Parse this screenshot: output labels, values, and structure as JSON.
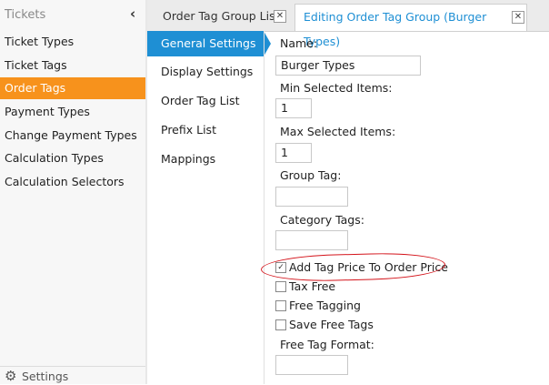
{
  "left_nav": {
    "header": "Tickets",
    "collapse_icon": "chevron-left-icon",
    "items": [
      "Ticket Types",
      "Ticket Tags",
      "Order Tags",
      "Payment Types",
      "Change Payment Types",
      "Calculation Types",
      "Calculation Selectors"
    ],
    "active_item": "Order Tags",
    "footer": {
      "icon": "gear-icon",
      "label": "Settings"
    },
    "accent_color": "#f7921c"
  },
  "tabs": [
    {
      "label": "Order Tag Group List",
      "active": false
    },
    {
      "label": "Editing Order Tag Group (Burger Types)",
      "active": true
    }
  ],
  "sections": {
    "items": [
      "General Settings",
      "Display Settings",
      "Order Tag List",
      "Prefix List",
      "Mappings"
    ],
    "active_item": "General Settings",
    "accent_color": "#1e8fd4"
  },
  "form": {
    "name_label": "Name:",
    "name_value": "Burger Types",
    "min_label": "Min Selected Items:",
    "min_value": "1",
    "max_label": "Max Selected Items:",
    "max_value": "1",
    "group_tag_label": "Group Tag:",
    "group_tag_value": "",
    "category_tags_label": "Category Tags:",
    "category_tags_value": "",
    "checkboxes": [
      {
        "label": "Add Tag Price To Order Price",
        "checked": true
      },
      {
        "label": "Tax Free",
        "checked": false
      },
      {
        "label": "Free Tagging",
        "checked": false
      },
      {
        "label": "Save Free Tags",
        "checked": false
      }
    ],
    "free_tag_format_label": "Free Tag Format:",
    "free_tag_format_value": ""
  },
  "annotation_color": "#d4141b"
}
